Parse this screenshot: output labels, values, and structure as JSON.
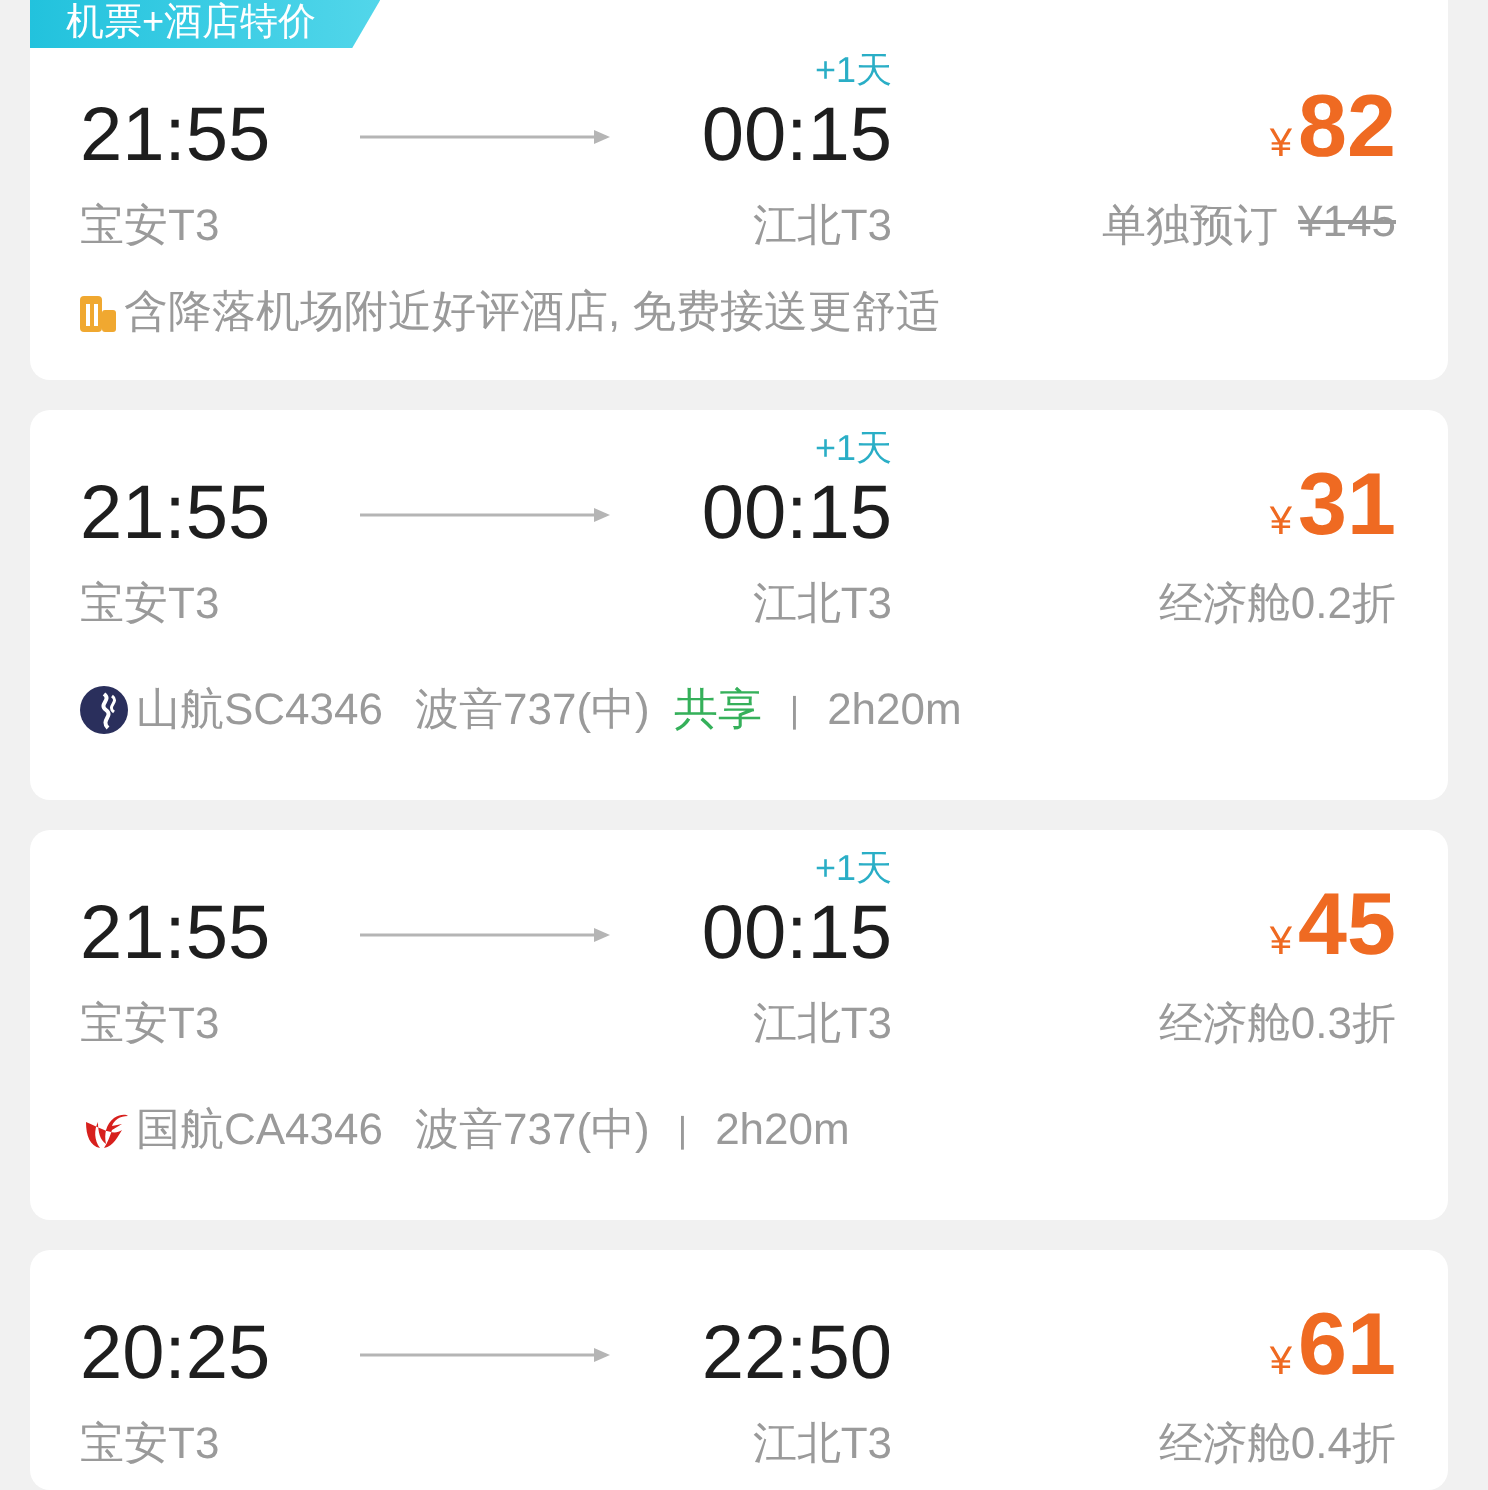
{
  "flights": [
    {
      "tag": "机票+酒店特价",
      "depart_time": "21:55",
      "arrive_time": "00:15",
      "plus_day": "+1天",
      "depart_airport": "宝安T3",
      "arrive_airport": "江北T3",
      "currency": "¥",
      "price": "82",
      "price_note": "单独预订",
      "original_price": "¥145",
      "info": {
        "kind": "hotel",
        "text": "含降落机场附近好评酒店, 免费接送更舒适"
      }
    },
    {
      "depart_time": "21:55",
      "arrive_time": "00:15",
      "plus_day": "+1天",
      "depart_airport": "宝安T3",
      "arrive_airport": "江北T3",
      "currency": "¥",
      "price": "31",
      "price_note": "经济舱0.2折",
      "info": {
        "kind": "flight",
        "logo": {
          "kind": "wave"
        },
        "flight_no": "山航SC4346",
        "aircraft": "波音737(中)",
        "shared": true,
        "shared_label": "共享",
        "separator": "|",
        "duration": "2h20m"
      }
    },
    {
      "depart_time": "21:55",
      "arrive_time": "00:15",
      "plus_day": "+1天",
      "depart_airport": "宝安T3",
      "arrive_airport": "江北T3",
      "currency": "¥",
      "price": "45",
      "price_note": "经济舱0.3折",
      "info": {
        "kind": "flight",
        "logo": {
          "kind": "bird"
        },
        "flight_no": "国航CA4346",
        "aircraft": "波音737(中)",
        "shared": false,
        "separator": "|",
        "duration": "2h20m"
      }
    },
    {
      "depart_time": "20:25",
      "arrive_time": "22:50",
      "depart_airport": "宝安T3",
      "arrive_airport": "江北T3",
      "currency": "¥",
      "price": "61",
      "price_note": "经济舱0.4折"
    }
  ]
}
